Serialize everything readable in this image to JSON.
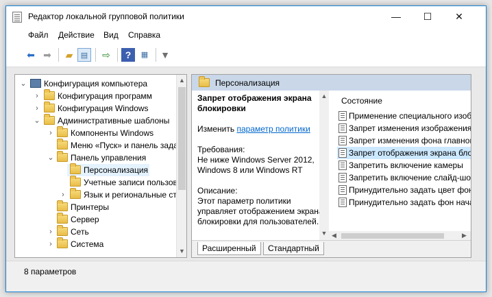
{
  "window": {
    "title": "Редактор локальной групповой политики"
  },
  "menu": {
    "items": [
      "Файл",
      "Действие",
      "Вид",
      "Справка"
    ]
  },
  "tree": {
    "items": [
      {
        "label": "Конфигурация компьютера",
        "toggle": "⌄"
      },
      {
        "label": "Конфигурация программ",
        "toggle": "›"
      },
      {
        "label": "Конфигурация Windows",
        "toggle": "›"
      },
      {
        "label": "Административные шаблоны",
        "toggle": "⌄"
      },
      {
        "label": "Компоненты Windows",
        "toggle": "›"
      },
      {
        "label": "Меню «Пуск» и панель задач",
        "toggle": ""
      },
      {
        "label": "Панель управления",
        "toggle": "⌄"
      },
      {
        "label": "Персонализация",
        "toggle": ""
      },
      {
        "label": "Учетные записи пользователей",
        "toggle": ""
      },
      {
        "label": "Язык и региональные стандарты",
        "toggle": "›"
      },
      {
        "label": "Принтеры",
        "toggle": ""
      },
      {
        "label": "Сервер",
        "toggle": ""
      },
      {
        "label": "Сеть",
        "toggle": "›"
      },
      {
        "label": "Система",
        "toggle": "›"
      }
    ]
  },
  "details": {
    "header": "Персонализация",
    "policy_title": "Запрет отображения экрана блокировки",
    "edit_prefix": "Изменить ",
    "edit_link": "параметр политики",
    "requirements_label": "Требования:",
    "requirements_text": "Не ниже Windows Server 2012, Windows 8 или Windows RT",
    "description_label": "Описание:",
    "description_text": "Этот параметр политики управляет отображением экрана блокировки для пользователей."
  },
  "list": {
    "column_header": "Состояние",
    "items": [
      "Применение специального изображения",
      "Запрет изменения изображения",
      "Запрет изменения фона главного",
      "Запрет отображения экрана блокировки",
      "Запретить включение камеры",
      "Запретить включение слайд-шоу",
      "Принудительно задать цвет фона",
      "Принудительно задать фон начального"
    ],
    "selected_index": 3
  },
  "tabs": {
    "extended": "Расширенный",
    "standard": "Стандартный"
  },
  "status": {
    "text": "8 параметров"
  }
}
